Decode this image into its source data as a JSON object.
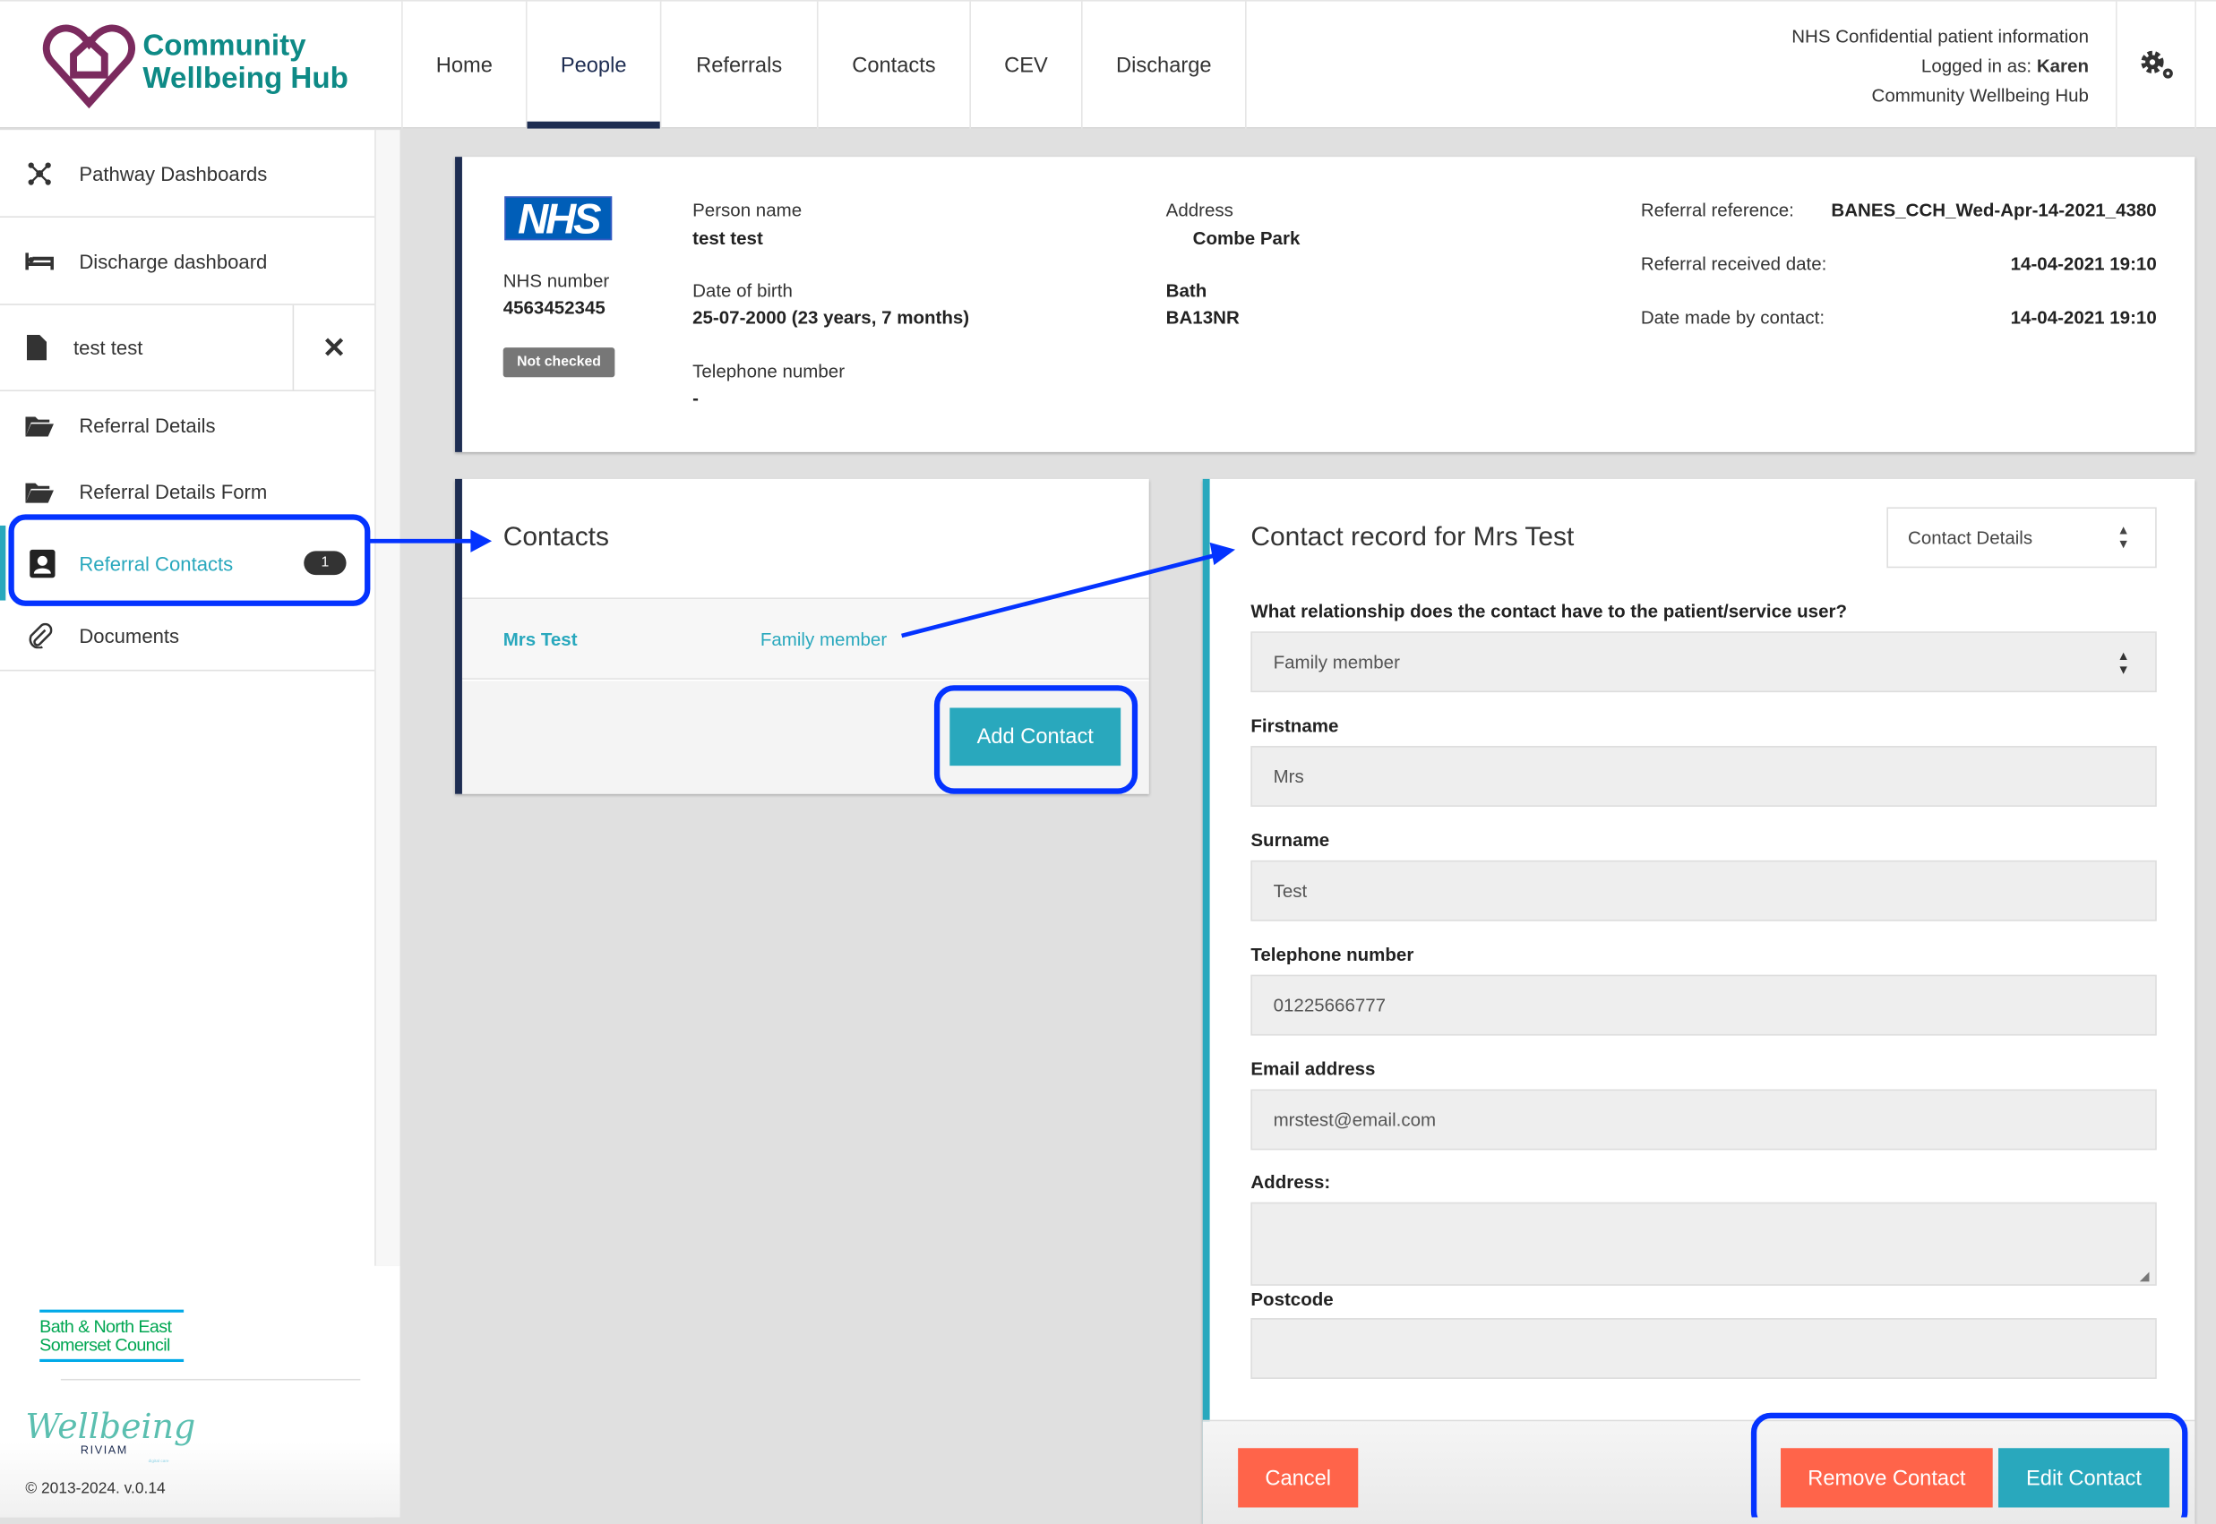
{
  "app": {
    "logo_line1": "Community",
    "logo_line2": "Wellbeing Hub"
  },
  "nav": {
    "tabs": [
      {
        "label": "Home"
      },
      {
        "label": "People",
        "active": true
      },
      {
        "label": "Referrals"
      },
      {
        "label": "Contacts"
      },
      {
        "label": "CEV"
      },
      {
        "label": "Discharge"
      }
    ]
  },
  "header_info": {
    "line1": "NHS Confidential patient information",
    "logged_prefix": "Logged in as:",
    "user": "Karen",
    "line3": "Community Wellbeing Hub"
  },
  "sidebar": {
    "items": [
      {
        "label": "Pathway Dashboards",
        "icon": "network-icon"
      },
      {
        "label": "Discharge dashboard",
        "icon": "bed-icon"
      },
      {
        "label": "test test",
        "icon": "file-icon"
      },
      {
        "label": "Referral Details",
        "icon": "folder-open-icon"
      },
      {
        "label": "Referral Details Form",
        "icon": "folder-open-icon"
      },
      {
        "label": "Referral Contacts",
        "icon": "contact-card-icon",
        "badge": "1",
        "active": true
      },
      {
        "label": "Documents",
        "icon": "paperclip-icon"
      }
    ],
    "footer": {
      "council_line1": "Bath & North East",
      "council_line2": "Somerset Council",
      "wellbeing": "Wellbeing",
      "riviam": "RIVIAM",
      "riviam_sub": "digital care",
      "copyright": "© 2013-2024. v.0.14"
    }
  },
  "patient": {
    "nhs_logo": "NHS",
    "nhs_number_label": "NHS number",
    "nhs_number": "4563452345",
    "status_badge": "Not checked",
    "person_name_label": "Person name",
    "person_name": "test test",
    "dob_label": "Date of birth",
    "dob": "25-07-2000 (23 years, 7 months)",
    "tel_label": "Telephone number",
    "tel": "-",
    "address_label": "Address",
    "address_line1": "Combe Park",
    "address_city": "Bath",
    "address_postcode": "BA13NR",
    "ref_label": "Referral reference:",
    "ref": "BANES_CCH_Wed-Apr-14-2021_4380",
    "received_label": "Referral received date:",
    "received": "14-04-2021 19:10",
    "made_label": "Date made by contact:",
    "made": "14-04-2021 19:10"
  },
  "contacts": {
    "title": "Contacts",
    "rows": [
      {
        "name": "Mrs Test",
        "relationship": "Family member"
      }
    ],
    "add_button": "Add Contact"
  },
  "record": {
    "title": "Contact record for Mrs Test",
    "view_select": "Contact Details",
    "relationship_label": "What relationship does the contact have to the patient/service user?",
    "relationship": "Family member",
    "firstname_label": "Firstname",
    "firstname": "Mrs",
    "surname_label": "Surname",
    "surname": "Test",
    "telephone_label": "Telephone number",
    "telephone": "01225666777",
    "email_label": "Email address",
    "email": "mrstest@email.com",
    "address_label": "Address:",
    "address": "",
    "postcode_label": "Postcode",
    "postcode": "",
    "cancel": "Cancel",
    "remove": "Remove Contact",
    "edit": "Edit Contact"
  },
  "colors": {
    "teal": "#29a8bd",
    "navy": "#1e2d52",
    "orange": "#ff644a",
    "annotation": "#0433ff"
  }
}
